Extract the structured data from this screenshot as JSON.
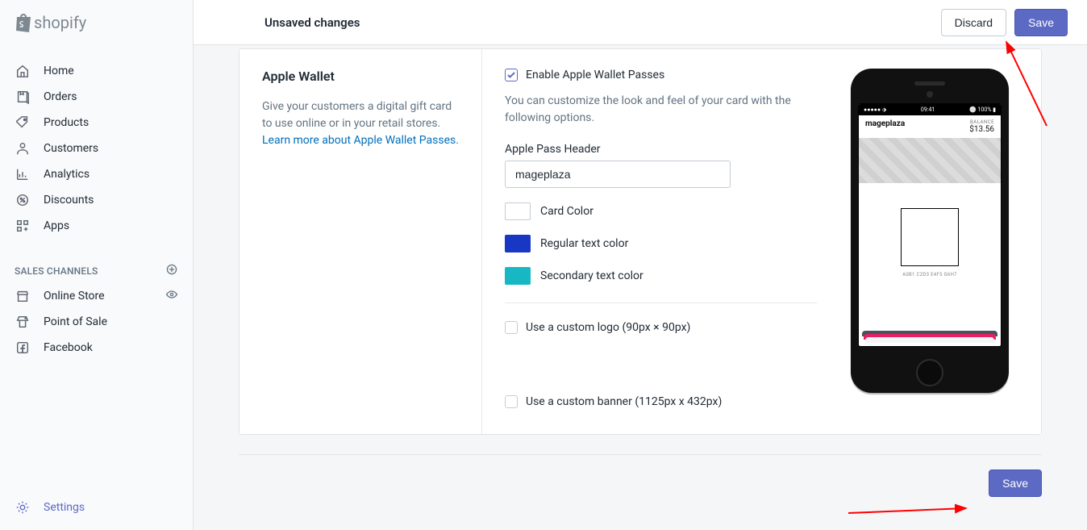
{
  "brand": "shopify",
  "topbar": {
    "title": "Unsaved changes",
    "discard": "Discard",
    "save": "Save"
  },
  "sidebar": {
    "items": [
      {
        "label": "Home"
      },
      {
        "label": "Orders"
      },
      {
        "label": "Products"
      },
      {
        "label": "Customers"
      },
      {
        "label": "Analytics"
      },
      {
        "label": "Discounts"
      },
      {
        "label": "Apps"
      }
    ],
    "channels_header": "SALES CHANNELS",
    "channels": [
      {
        "label": "Online Store"
      },
      {
        "label": "Point of Sale"
      },
      {
        "label": "Facebook"
      }
    ],
    "settings": "Settings"
  },
  "section": {
    "title": "Apple Wallet",
    "description": "Give your customers a digital gift card to use online or in your retail stores.",
    "learn_more": "Learn more about Apple Wallet Passes."
  },
  "form": {
    "enable_label": "Enable Apple Wallet Passes",
    "enable_checked": true,
    "help_text": "You can customize the look and feel of your card with the following options.",
    "header_label": "Apple Pass Header",
    "header_value": "mageplaza",
    "swatches": [
      {
        "label": "Card Color",
        "color": "#ffffff"
      },
      {
        "label": "Regular text color",
        "color": "#1837c4"
      },
      {
        "label": "Secondary text color",
        "color": "#17b8c4"
      }
    ],
    "custom_logo_label": "Use a custom logo (90px × 90px)",
    "custom_banner_label": "Use a custom banner (1125px x 432px)"
  },
  "preview": {
    "status_time": "09:41",
    "status_left": "●●●●● ⬗",
    "status_right": "⚪ 100% ▮",
    "brand": "mageplaza",
    "balance_label": "BALANCE",
    "balance_value": "$13.56",
    "qr_caption": "A0B1 C2D3 E4F5 G6H7"
  },
  "footer": {
    "save": "Save"
  }
}
